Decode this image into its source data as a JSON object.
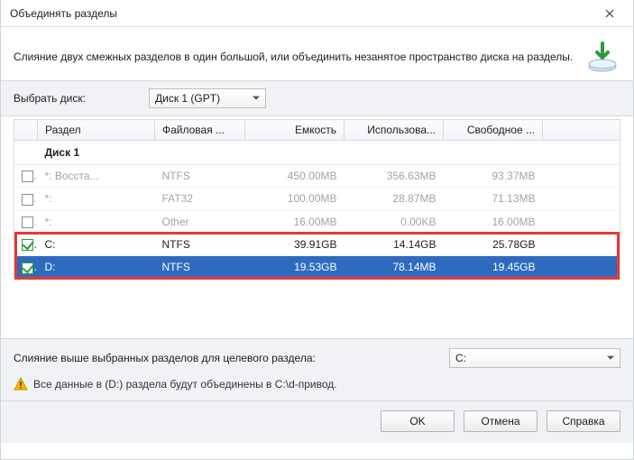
{
  "window": {
    "title": "Объединять разделы"
  },
  "description": "Слияние двух смежных разделов в один большой, или объединить незанятое пространство диска на разделы.",
  "disk_select": {
    "label": "Выбрать диск:",
    "value": "Диск 1 (GPT)"
  },
  "columns": {
    "partition": "Раздел",
    "filesystem": "Файловая ...",
    "capacity": "Емкость",
    "used": "Использова...",
    "free": "Свободное ..."
  },
  "group_label": "Диск 1",
  "rows": [
    {
      "checked": false,
      "enabled": false,
      "name": "*: Восста...",
      "fs": "NTFS",
      "cap": "450.00MB",
      "used": "356.63MB",
      "free": "93.37MB"
    },
    {
      "checked": false,
      "enabled": false,
      "name": "*:",
      "fs": "FAT32",
      "cap": "100.00MB",
      "used": "28.87MB",
      "free": "71.13MB"
    },
    {
      "checked": false,
      "enabled": false,
      "name": "*:",
      "fs": "Other",
      "cap": "16.00MB",
      "used": "0.00KB",
      "free": "16.00MB"
    },
    {
      "checked": true,
      "enabled": true,
      "name": "C:",
      "fs": "NTFS",
      "cap": "39.91GB",
      "used": "14.14GB",
      "free": "25.78GB",
      "framed": true
    },
    {
      "checked": true,
      "enabled": true,
      "name": "D:",
      "fs": "NTFS",
      "cap": "19.53GB",
      "used": "78.14MB",
      "free": "19.45GB",
      "framed": true,
      "selected": true
    }
  ],
  "target": {
    "label": "Слияние выше выбранных разделов для целевого раздела:",
    "value": "C:"
  },
  "warning": "Все данные в (D:) раздела будут объединены в C:\\d-привод.",
  "buttons": {
    "ok": "OK",
    "cancel": "Отмена",
    "help": "Справка"
  }
}
